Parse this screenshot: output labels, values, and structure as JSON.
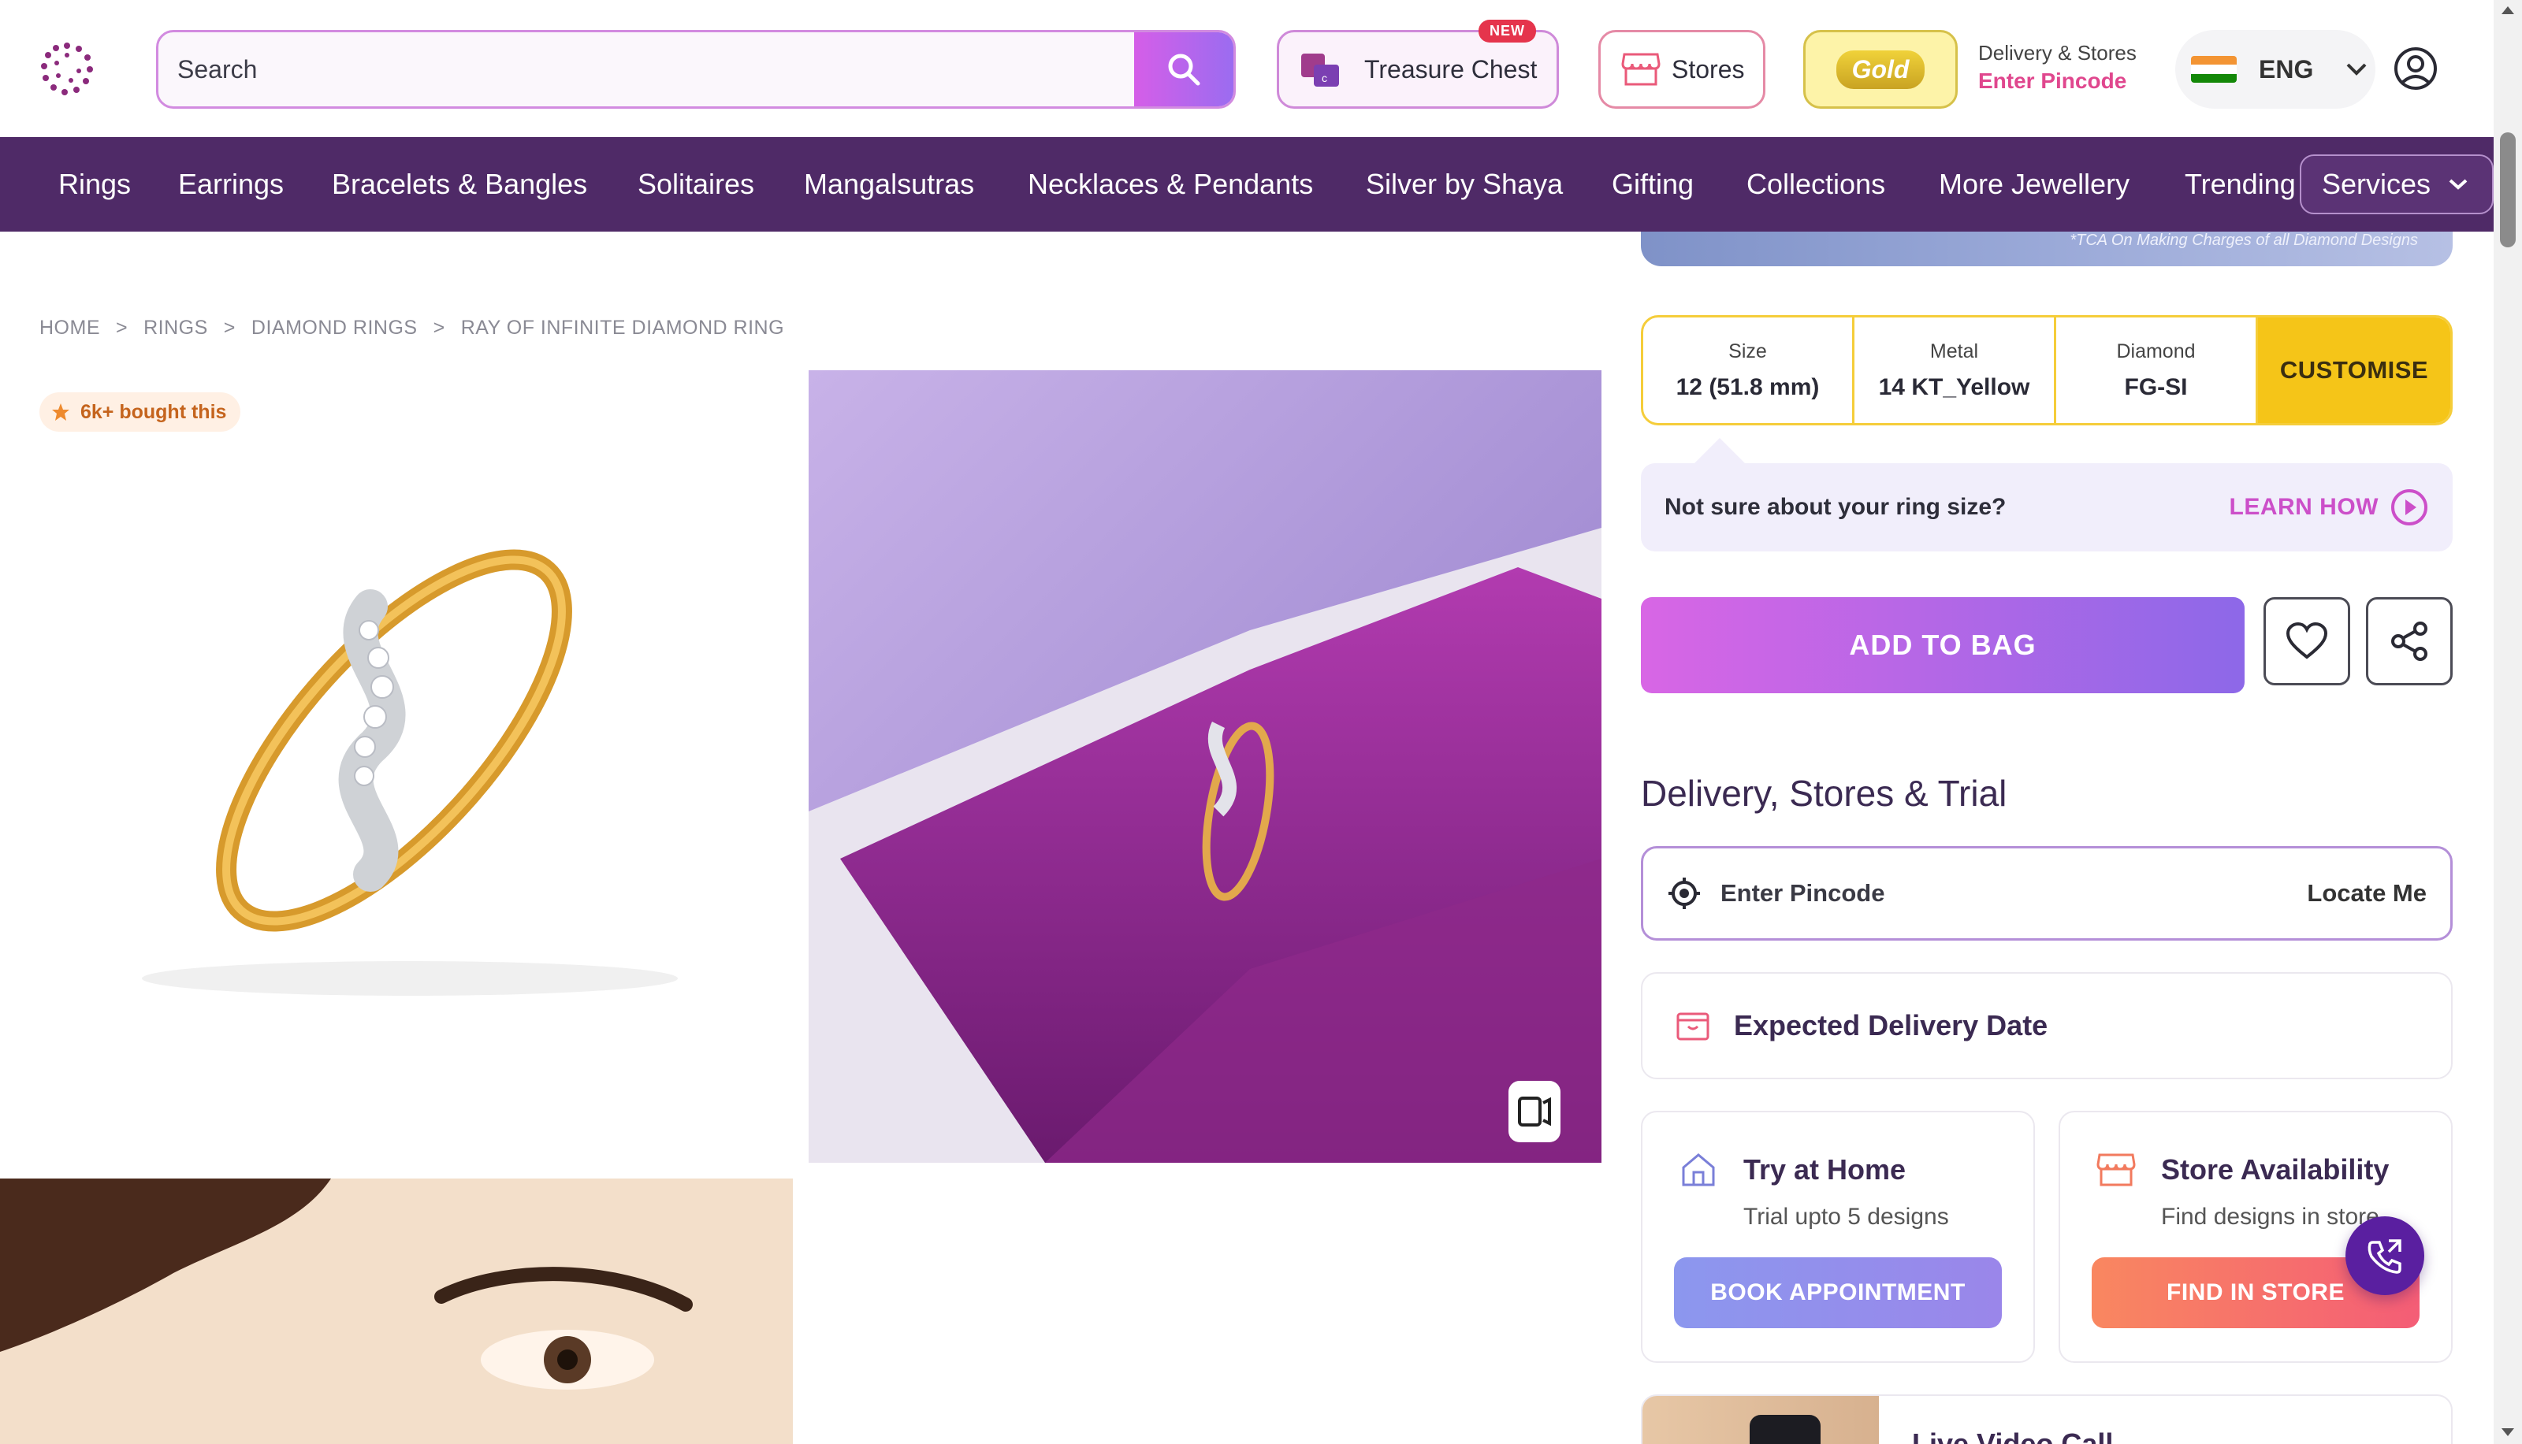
{
  "header": {
    "search_placeholder": "Search",
    "treasure_chest": {
      "label": "Treasure Chest",
      "badge": "NEW"
    },
    "stores_label": "Stores",
    "gold_label": "Gold",
    "delivery": {
      "label": "Delivery & Stores",
      "pincode_prompt": "Enter Pincode"
    },
    "language": "ENG",
    "icons": [
      "logo-icon",
      "search-icon",
      "treasure-chest-icon",
      "store-icon",
      "india-flag-icon",
      "chevron-down-icon",
      "account-icon"
    ]
  },
  "nav": {
    "items": [
      "Rings",
      "Earrings",
      "Bracelets & Bangles",
      "Solitaires",
      "Mangalsutras",
      "Necklaces & Pendants",
      "Silver by Shaya",
      "Gifting",
      "Collections",
      "More Jewellery",
      "Trending"
    ],
    "services_label": "Services"
  },
  "breadcrumb": [
    "HOME",
    "RINGS",
    "DIAMOND RINGS",
    "RAY OF INFINITE DIAMOND RING"
  ],
  "breadcrumb_separator": ">",
  "gallery": {
    "bought_badge": "6k+ bought this"
  },
  "product": {
    "banner_note": "*TCA On Making Charges of all Diamond Designs",
    "specs": [
      {
        "label": "Size",
        "value": "12 (51.8 mm)"
      },
      {
        "label": "Metal",
        "value": "14 KT_Yellow"
      },
      {
        "label": "Diamond",
        "value": "FG-SI"
      }
    ],
    "customise_label": "CUSTOMISE",
    "size_help": {
      "text": "Not sure about your ring size?",
      "link": "LEARN HOW"
    },
    "add_to_bag_label": "ADD TO BAG"
  },
  "delivery_section": {
    "title": "Delivery, Stores & Trial",
    "pincode_placeholder": "Enter Pincode",
    "locate_label": "Locate Me",
    "expected_delivery": "Expected Delivery Date",
    "try_at_home": {
      "title": "Try at Home",
      "subtitle": "Trial upto 5 designs",
      "button": "BOOK APPOINTMENT"
    },
    "store_availability": {
      "title": "Store Availability",
      "subtitle": "Find designs in store",
      "button": "FIND IN STORE"
    },
    "live_video": {
      "title": "Live Video Call"
    }
  },
  "colors": {
    "nav_bg": "#4f2a67",
    "accent_pink": "#e0478e",
    "customise_yellow": "#f5c518",
    "add_to_bag_gradient": [
      "#d866e5",
      "#8d68e8"
    ]
  }
}
